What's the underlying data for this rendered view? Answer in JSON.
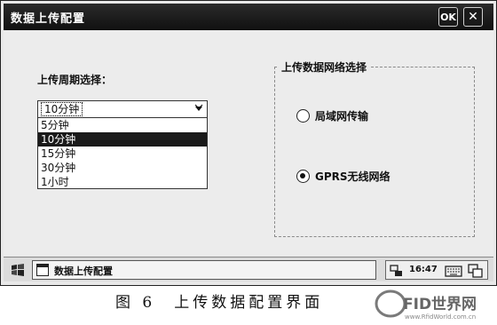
{
  "window": {
    "title": "数据上传配置",
    "ok_label": "OK",
    "close_glyph": "✕"
  },
  "period": {
    "label": "上传周期选择：",
    "combo_value": "10分钟",
    "options": [
      "5分钟",
      "10分钟",
      "15分钟",
      "30分钟",
      "1小时"
    ],
    "selected_index": 1
  },
  "network": {
    "group_title": "上传数据网络选择",
    "options": [
      {
        "label": "局域网传输",
        "checked": false
      },
      {
        "label": "GPRS无线网络",
        "checked": true
      }
    ]
  },
  "taskbar": {
    "task_label": "数据上传配置",
    "time": "16:47"
  },
  "caption": "图 6　上传数据配置界面",
  "icons": {
    "start": "windows-flag-icon",
    "task": "window-icon",
    "network": "network-icon",
    "keyboard": "keyboard-icon",
    "desktop": "desktop-icon"
  },
  "colors": {
    "titlebar": "#1a1a1a",
    "selection": "#1a1a1a",
    "client": "#ececec"
  }
}
